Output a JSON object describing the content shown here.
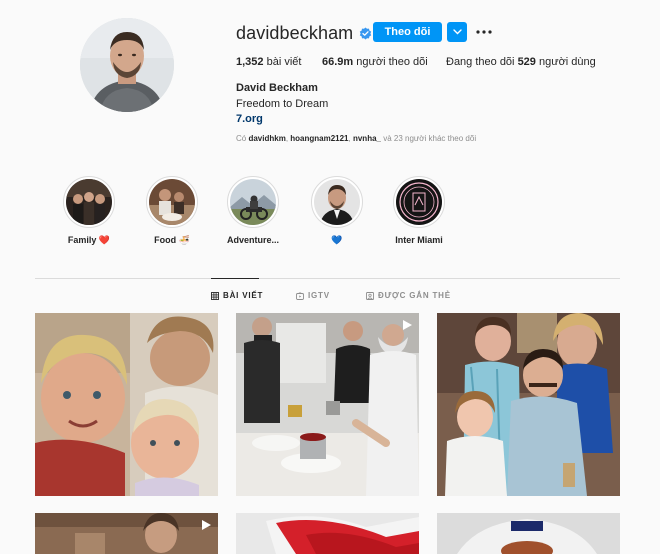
{
  "profile": {
    "username": "davidbeckham",
    "follow_label": "Theo dõi",
    "stats": {
      "posts_count": "1,352",
      "posts_label": "bài viết",
      "followers_count": "66.9m",
      "followers_label": "người theo dõi",
      "following_prefix": "Đang theo dõi",
      "following_count": "529",
      "following_suffix": "người dùng"
    },
    "full_name": "David Beckham",
    "bio": "Freedom to Dream",
    "link": "7.org",
    "followed_by": {
      "prefix": "Có",
      "user1": "davidhkm",
      "user2": "hoangnam2121",
      "user3": "nvnha_",
      "suffix": "và 23 người khác theo dõi"
    }
  },
  "highlights": [
    {
      "label": "Family ❤️"
    },
    {
      "label": "Food 🍜"
    },
    {
      "label": "Adventure..."
    },
    {
      "label": "💙"
    },
    {
      "label": "Inter Miami"
    }
  ],
  "tabs": [
    {
      "label": "BÀI VIẾT",
      "active": true
    },
    {
      "label": "IGTV",
      "active": false
    },
    {
      "label": "ĐƯỢC GẮN THẺ",
      "active": false
    }
  ],
  "posts": [
    {
      "type": "photo"
    },
    {
      "type": "video"
    },
    {
      "type": "photo"
    },
    {
      "type": "video"
    },
    {
      "type": "photo"
    },
    {
      "type": "photo"
    }
  ],
  "colors": {
    "accent": "#0095f6",
    "verified": "#3897f0",
    "link": "#00376b",
    "muted": "#8e8e8e"
  },
  "icons": [
    "verified-badge-icon",
    "chevron-down-icon",
    "more-options-icon",
    "grid-icon",
    "igtv-icon",
    "tagged-icon",
    "video-icon"
  ]
}
